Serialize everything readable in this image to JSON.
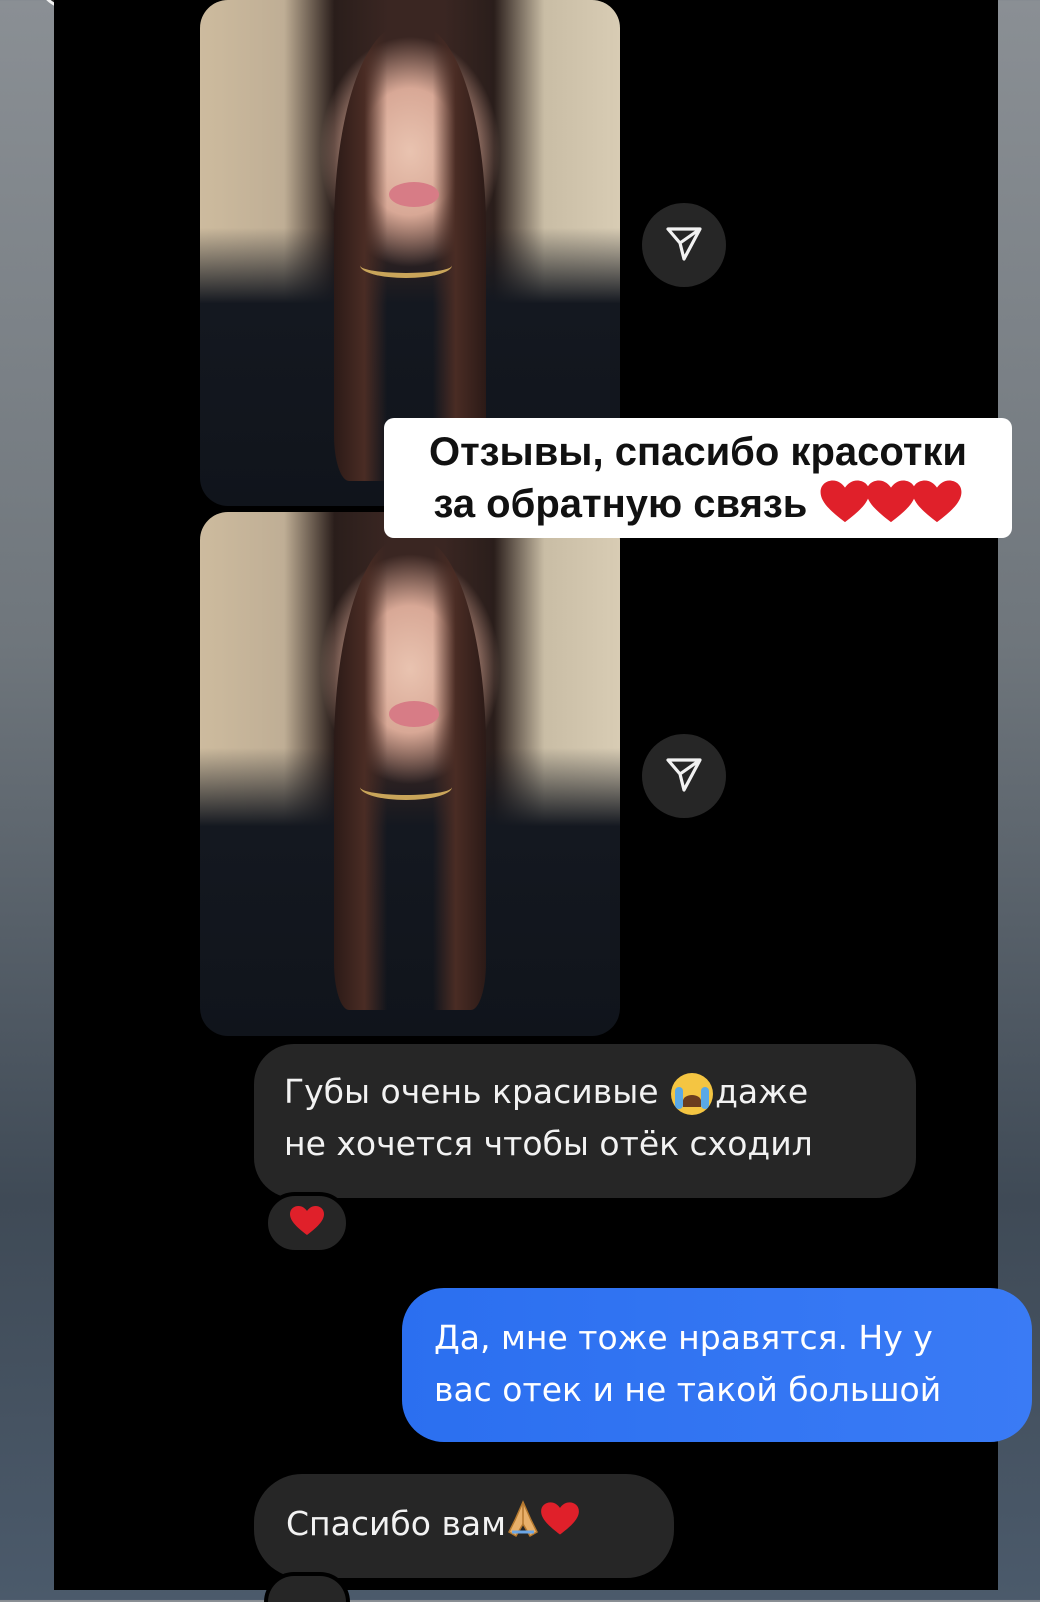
{
  "colors": {
    "chat_background": "#000000",
    "incoming_bubble": "#262626",
    "outgoing_bubble": "#3a7bf5",
    "reaction_heart": "#e0202a"
  },
  "icons": {
    "share": "paper-plane-icon",
    "reaction": "red-heart-icon",
    "crying": "loudly-crying-face-icon",
    "pray": "folded-hands-icon"
  },
  "caption": {
    "line1": "Отзывы, спасибо красотки",
    "line2": "за обратную связь"
  },
  "messages": [
    {
      "direction": "incoming",
      "line1_text": "Губы очень красивые",
      "line1_after": "даже",
      "line2": "не хочется чтобы отёк сходил"
    },
    {
      "direction": "outgoing",
      "line1": "Да, мне тоже нравятся. Ну у",
      "line2": "вас отек и не такой большой"
    },
    {
      "direction": "incoming",
      "text": "Спасибо вам"
    }
  ]
}
